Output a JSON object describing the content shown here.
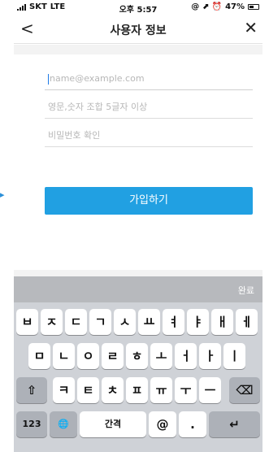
{
  "status_bar": {
    "carrier": "SKT",
    "network": "LTE",
    "time": "오후 5:57",
    "indicators": "@ ⬈ ⏰",
    "battery": "47%"
  },
  "nav": {
    "back_icon": "chevron-left-icon",
    "title": "사용자 정보",
    "close_icon": "close-icon"
  },
  "form": {
    "email_placeholder": "name@example.com",
    "password_placeholder": "영문,숫자 조합 5글자 이상",
    "confirm_placeholder": "비밀번호 확인",
    "submit_label": "가입하기"
  },
  "keyboard": {
    "done_label": "완료",
    "row1": [
      "ㅂ",
      "ㅈ",
      "ㄷ",
      "ㄱ",
      "ㅅ",
      "ㅛ",
      "ㅕ",
      "ㅑ",
      "ㅐ",
      "ㅔ"
    ],
    "row2": [
      "ㅁ",
      "ㄴ",
      "ㅇ",
      "ㄹ",
      "ㅎ",
      "ㅗ",
      "ㅓ",
      "ㅏ",
      "ㅣ"
    ],
    "row3": [
      "ㅋ",
      "ㅌ",
      "ㅊ",
      "ㅍ",
      "ㅠ",
      "ㅜ",
      "ㅡ"
    ],
    "shift_glyph": "⇧",
    "delete_glyph": "⌫",
    "numbers_label": "123",
    "globe_glyph": "🌐",
    "space_label": "간격",
    "at_label": "@",
    "period_label": ".",
    "return_glyph": "↵"
  },
  "colors": {
    "accent": "#21a0e2",
    "caret": "#1e7be6",
    "keyboard_bg": "#cfd2d7",
    "accessory_bg": "#b7b9bd"
  }
}
